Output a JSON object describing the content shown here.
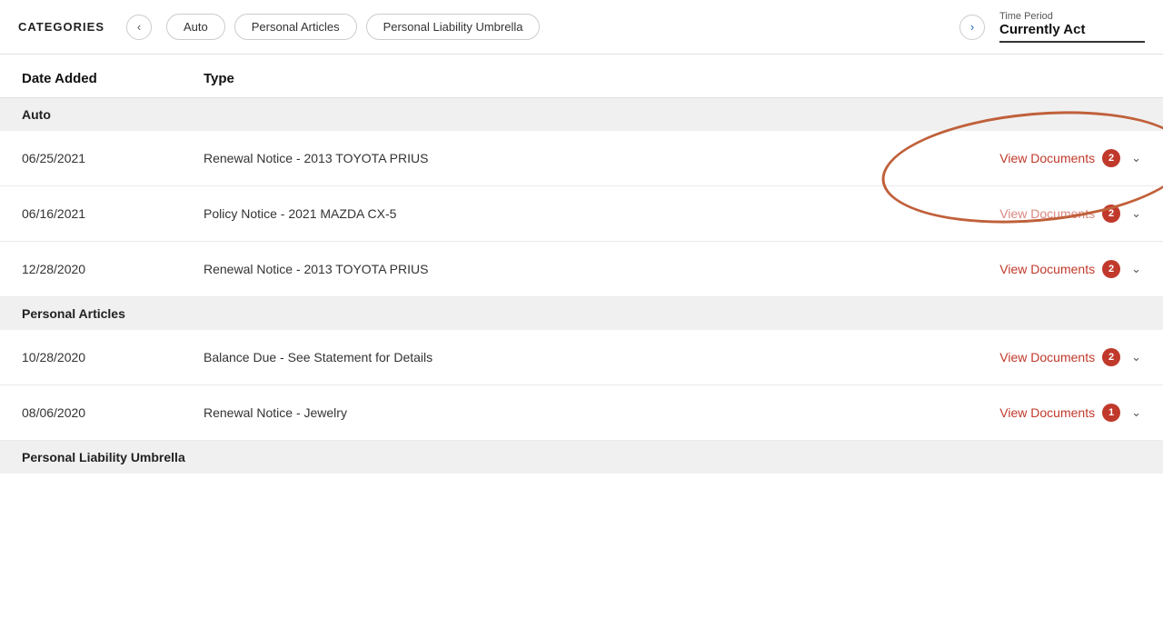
{
  "header": {
    "categories_label": "CATEGORIES",
    "tabs": [
      {
        "label": "Auto",
        "id": "auto"
      },
      {
        "label": "Personal Articles",
        "id": "personal-articles"
      },
      {
        "label": "Personal Liability Umbrella",
        "id": "personal-liability-umbrella"
      }
    ],
    "time_period_label": "Time Period",
    "time_period_value": "Currently Act"
  },
  "table": {
    "col_date": "Date Added",
    "col_type": "Type",
    "sections": [
      {
        "section_label": "Auto",
        "rows": [
          {
            "date": "06/25/2021",
            "type": "Renewal Notice - 2013 TOYOTA PRIUS",
            "action_label": "View Documents",
            "badge_count": "2",
            "highlighted": true
          },
          {
            "date": "06/16/2021",
            "type": "Policy Notice - 2021 MAZDA CX-5",
            "action_label": "View Documents",
            "badge_count": "2",
            "highlighted": false
          },
          {
            "date": "12/28/2020",
            "type": "Renewal Notice - 2013 TOYOTA PRIUS",
            "action_label": "View Documents",
            "badge_count": "2",
            "highlighted": false
          }
        ]
      },
      {
        "section_label": "Personal Articles",
        "rows": [
          {
            "date": "10/28/2020",
            "type": "Balance Due - See Statement for Details",
            "action_label": "View Documents",
            "badge_count": "2",
            "highlighted": false
          },
          {
            "date": "08/06/2020",
            "type": "Renewal Notice - Jewelry",
            "action_label": "View Documents",
            "badge_count": "1",
            "highlighted": false
          }
        ]
      },
      {
        "section_label": "Personal Liability Umbrella",
        "rows": []
      }
    ]
  }
}
